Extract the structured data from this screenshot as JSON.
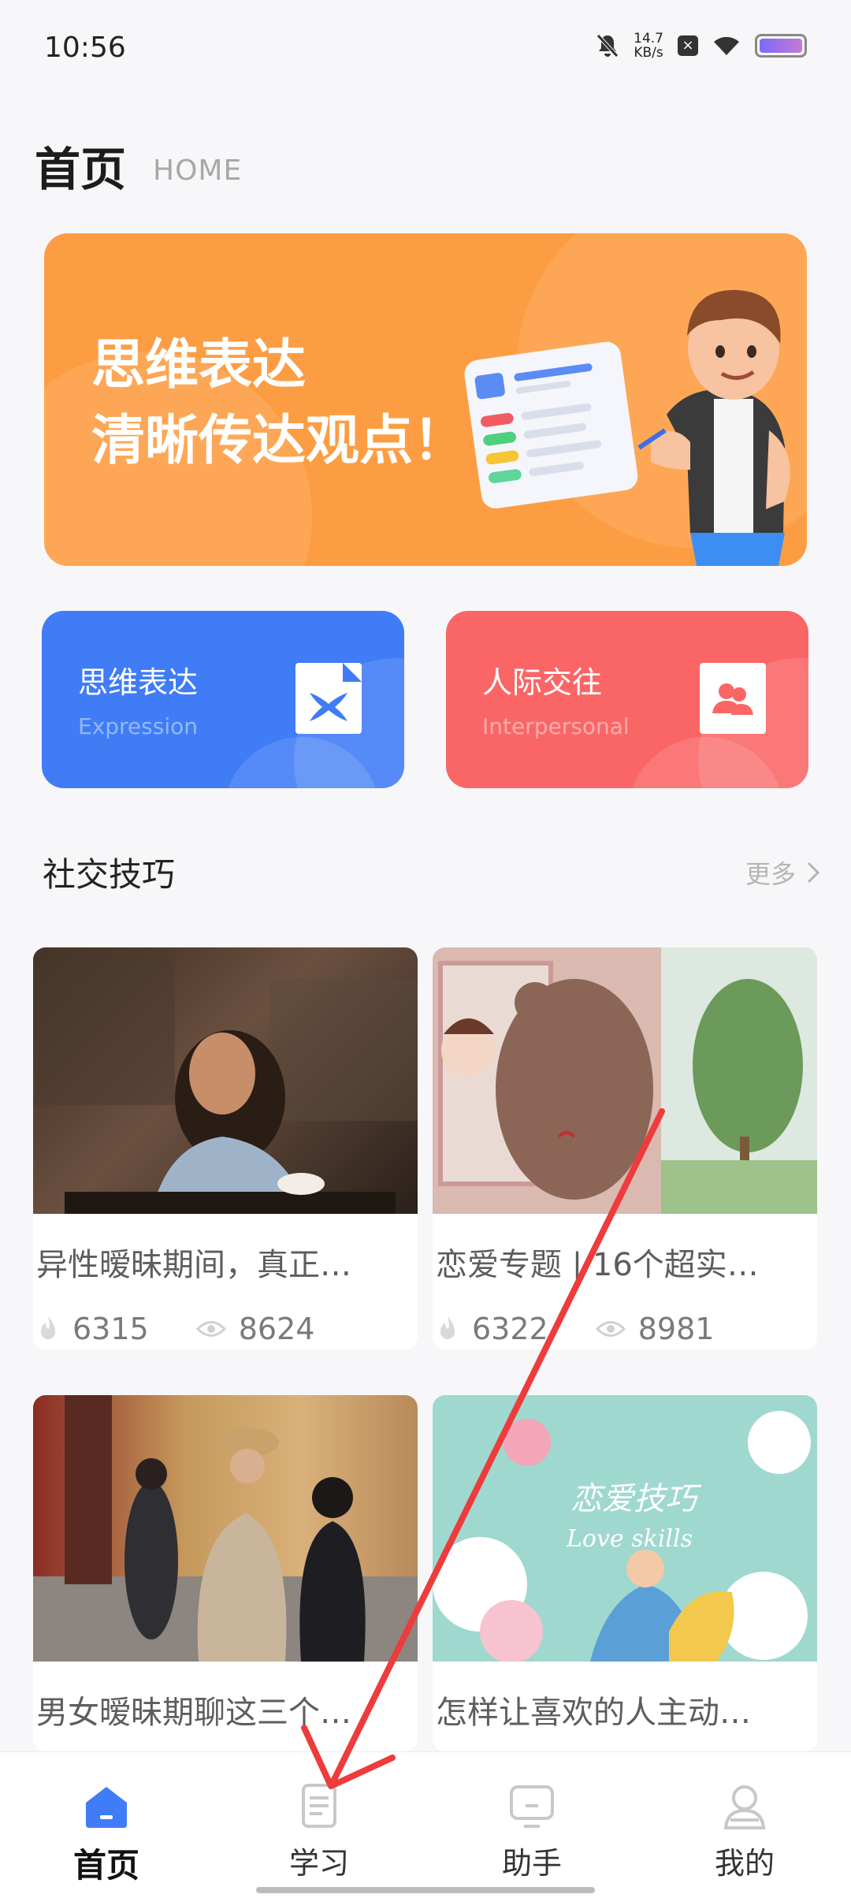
{
  "status_bar": {
    "time": "10:56",
    "net_speed_value": "14.7",
    "net_speed_unit": "KB/s"
  },
  "header": {
    "title": "首页",
    "subtitle": "HOME"
  },
  "banner": {
    "line1": "思维表达",
    "line2": "清晰传达观点！",
    "bg_color": "#fd9d43"
  },
  "categories": [
    {
      "title": "思维表达",
      "subtitle": "Expression",
      "color": "#3f7cf6",
      "icon": "expression-icon"
    },
    {
      "title": "人际交往",
      "subtitle": "Interpersonal",
      "color": "#fa6666",
      "icon": "people-icon"
    }
  ],
  "section": {
    "title": "社交技巧",
    "more": "更多"
  },
  "articles": [
    {
      "title": "异性暧昧期间，真正…",
      "likes": "6315",
      "views": "8624"
    },
    {
      "title": "恋爱专题 | 16个超实…",
      "likes": "6322",
      "views": "8981"
    },
    {
      "title": "男女暧昧期聊这三个…"
    },
    {
      "title": "怎样让喜欢的人主动…",
      "image_text_cn": "恋爱技巧",
      "image_text_en": "Love skills"
    }
  ],
  "bottom_nav": {
    "items": [
      {
        "label": "首页",
        "icon": "home-icon",
        "active": true
      },
      {
        "label": "学习",
        "icon": "study-icon",
        "active": false
      },
      {
        "label": "助手",
        "icon": "assistant-icon",
        "active": false
      },
      {
        "label": "我的",
        "icon": "profile-icon",
        "active": false
      }
    ],
    "active_color": "#3f7cf6"
  }
}
